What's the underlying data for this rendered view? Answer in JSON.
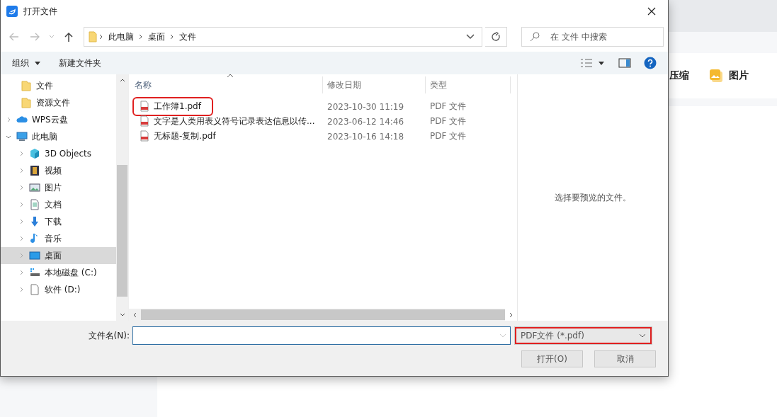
{
  "background_app": {
    "tools": [
      {
        "kind": "plain",
        "label": "压缩"
      },
      {
        "kind": "image",
        "label": "图片"
      }
    ]
  },
  "window": {
    "title": "打开文件"
  },
  "address": {
    "crumbs": [
      "此电脑",
      "桌面",
      "文件"
    ]
  },
  "search": {
    "placeholder": "在 文件 中搜索"
  },
  "toolbar": {
    "organize": "组织",
    "new_folder": "新建文件夹"
  },
  "sidebar": {
    "items": [
      {
        "label": "文件",
        "kind": "folder",
        "selected": false
      },
      {
        "label": "资源文件",
        "kind": "folder",
        "selected": false
      },
      {
        "label": "WPS云盘",
        "kind": "cloud",
        "selected": false,
        "expanded": false
      },
      {
        "label": "此电脑",
        "kind": "pc",
        "selected": false,
        "expanded": true,
        "children": [
          {
            "label": "3D Objects",
            "kind": "cube",
            "selected": false,
            "expanded": false
          },
          {
            "label": "视频",
            "kind": "film",
            "selected": false,
            "expanded": false
          },
          {
            "label": "图片",
            "kind": "picture",
            "selected": false,
            "expanded": false
          },
          {
            "label": "文档",
            "kind": "doc",
            "selected": false,
            "expanded": false
          },
          {
            "label": "下载",
            "kind": "download",
            "selected": false,
            "expanded": false
          },
          {
            "label": "音乐",
            "kind": "music",
            "selected": false,
            "expanded": false
          },
          {
            "label": "桌面",
            "kind": "desktop",
            "selected": true,
            "expanded": false
          },
          {
            "label": "本地磁盘 (C:)",
            "kind": "drive",
            "selected": false,
            "expanded": false
          },
          {
            "label": "软件 (D:)",
            "kind": "blank",
            "selected": false,
            "expanded": false
          }
        ]
      }
    ]
  },
  "table": {
    "columns": [
      "名称",
      "修改日期",
      "类型"
    ],
    "rows": [
      {
        "name": "工作簿1.pdf",
        "modified": "2023-10-30 11:19",
        "type": "PDF 文件",
        "highlighted": true
      },
      {
        "name": "文字是人类用表义符号记录表达信息以传...",
        "modified": "2023-06-12 14:46",
        "type": "PDF 文件",
        "highlighted": false
      },
      {
        "name": "无标题-复制.pdf",
        "modified": "2023-10-16 14:18",
        "type": "PDF 文件",
        "highlighted": false
      }
    ]
  },
  "preview": {
    "message": "选择要预览的文件。"
  },
  "footer": {
    "filename_label": "文件名(N):",
    "filetype": {
      "value": "PDF文件 (*.pdf)",
      "highlighted": true
    },
    "buttons": [
      "打开(O)",
      "取消"
    ]
  }
}
